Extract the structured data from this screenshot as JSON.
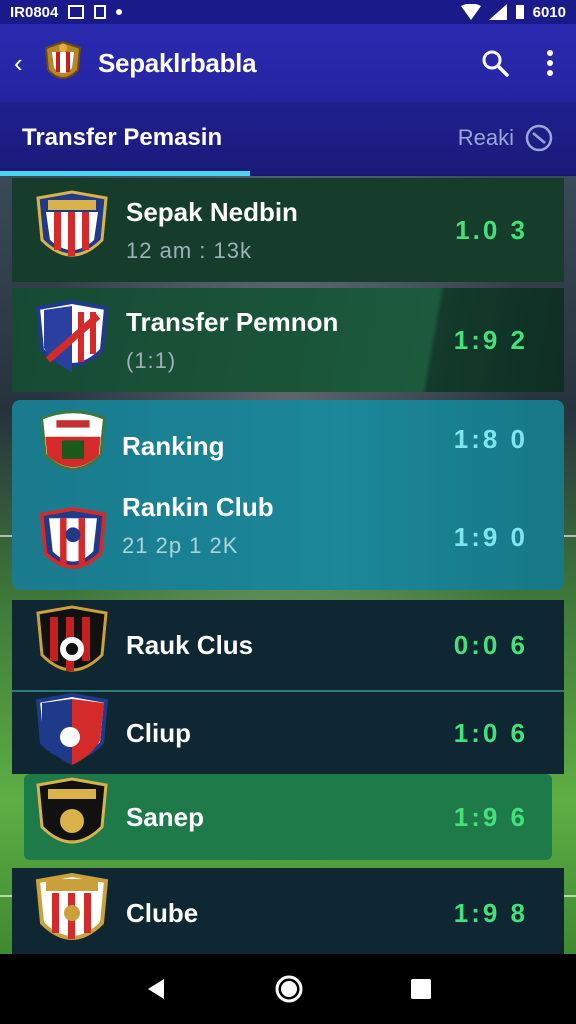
{
  "status_bar": {
    "time": "IR0804",
    "clock": "6010"
  },
  "app_bar": {
    "title": "Sepaklrbabla",
    "icons": [
      "back-arrow-icon",
      "club-crest-icon",
      "search-icon",
      "more-vertical-icon"
    ]
  },
  "tabs": {
    "active_label": "Transfer Pemasin",
    "right_label": "Reaki"
  },
  "rows": [
    {
      "name": "Sepak Nedbin",
      "sub": "12 am : 13k",
      "score": "1.0 3",
      "score_color": "#46e07a"
    },
    {
      "name": "Transfer Pemnon",
      "sub": "(1:1)",
      "score": "1:9 2",
      "score_color": "#46e07a"
    },
    {
      "name": "Ranking",
      "score": "1:8 0",
      "score_color": "#7fe6f0"
    },
    {
      "name": "Rankin Club",
      "sub": "21 2p   1 2K",
      "score": "1:9 0",
      "score_color": "#7fe6f0"
    },
    {
      "name": "Rauk Clus",
      "score": "0:0 6",
      "score_color": "#46e07a"
    },
    {
      "name": "Cliup",
      "score": "1:0 6",
      "score_color": "#46e07a"
    },
    {
      "name": "Sanep",
      "score": "1:9 6",
      "score_color": "#46e07a"
    },
    {
      "name": "Clube",
      "score": "1:9 8",
      "score_color": "#46e07a"
    }
  ],
  "nav_bar": {
    "icons": [
      "back-triangle-icon",
      "home-circle-icon",
      "recents-square-icon"
    ]
  }
}
